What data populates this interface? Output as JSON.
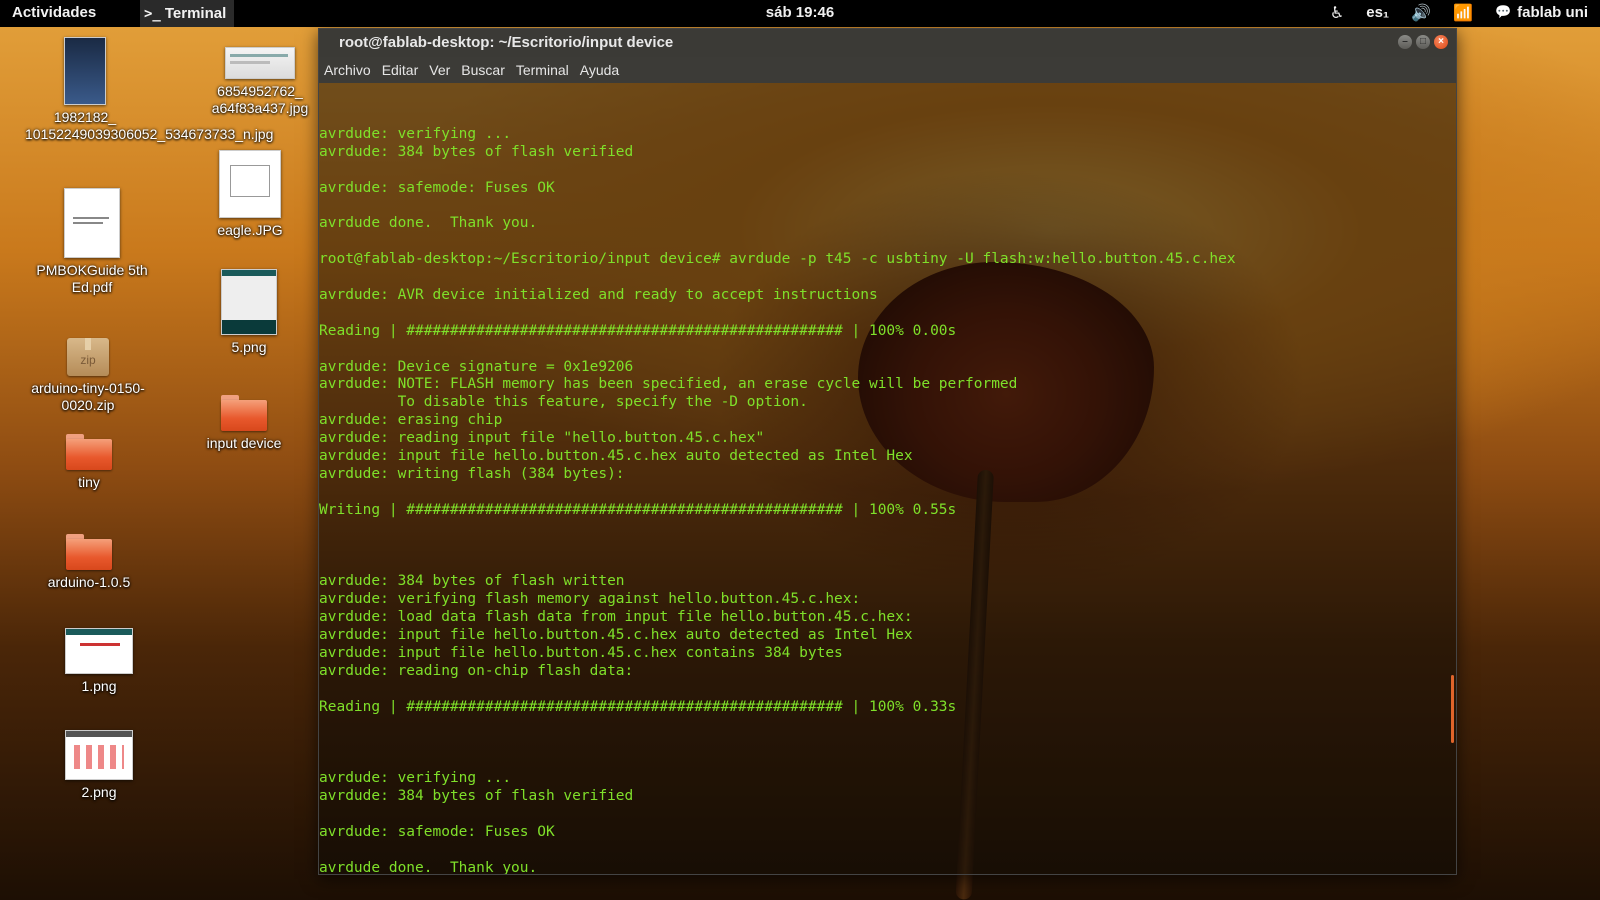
{
  "top_panel": {
    "activities": "Actividades",
    "app_name": "Terminal",
    "app_glyph": ">_",
    "clock": "sáb 19:46",
    "keyboard_layout": "es₁",
    "user": "fablab uni"
  },
  "desktop": {
    "icons": [
      {
        "label": "1982182_\n10152249039306052_534673733_n.jpg",
        "kind": "image-thumbnail"
      },
      {
        "label": "6854952762_\na64f83a437.jpg",
        "kind": "image-thumbnail"
      },
      {
        "label": "PMBOKGuide 5th Ed.pdf",
        "kind": "pdf-document"
      },
      {
        "label": "eagle.JPG",
        "kind": "image-thumbnail"
      },
      {
        "label": "5.png",
        "kind": "image-thumbnail"
      },
      {
        "label": "arduino-tiny-0150-0020.zip",
        "kind": "zip-archive"
      },
      {
        "label": "input device",
        "kind": "folder"
      },
      {
        "label": "tiny",
        "kind": "folder"
      },
      {
        "label": "arduino-1.0.5",
        "kind": "folder"
      },
      {
        "label": "1.png",
        "kind": "image-thumbnail"
      },
      {
        "label": "2.png",
        "kind": "image-thumbnail"
      }
    ]
  },
  "terminal": {
    "title": "root@fablab-desktop: ~/Escritorio/input device",
    "menu": [
      "Archivo",
      "Editar",
      "Ver",
      "Buscar",
      "Terminal",
      "Ayuda"
    ],
    "text_color": "#7fe02a",
    "lines": [
      "avrdude: verifying ...",
      "avrdude: 384 bytes of flash verified",
      "",
      "avrdude: safemode: Fuses OK",
      "",
      "avrdude done.  Thank you.",
      "",
      "root@fablab-desktop:~/Escritorio/input device# avrdude -p t45 -c usbtiny -U flash:w:hello.button.45.c.hex",
      "",
      "avrdude: AVR device initialized and ready to accept instructions",
      "",
      "Reading | ################################################## | 100% 0.00s",
      "",
      "avrdude: Device signature = 0x1e9206",
      "avrdude: NOTE: FLASH memory has been specified, an erase cycle will be performed",
      "         To disable this feature, specify the -D option.",
      "avrdude: erasing chip",
      "avrdude: reading input file \"hello.button.45.c.hex\"",
      "avrdude: input file hello.button.45.c.hex auto detected as Intel Hex",
      "avrdude: writing flash (384 bytes):",
      "",
      "Writing | ################################################## | 100% 0.55s",
      "",
      "",
      "",
      "avrdude: 384 bytes of flash written",
      "avrdude: verifying flash memory against hello.button.45.c.hex:",
      "avrdude: load data flash data from input file hello.button.45.c.hex:",
      "avrdude: input file hello.button.45.c.hex auto detected as Intel Hex",
      "avrdude: input file hello.button.45.c.hex contains 384 bytes",
      "avrdude: reading on-chip flash data:",
      "",
      "Reading | ################################################## | 100% 0.33s",
      "",
      "",
      "",
      "avrdude: verifying ...",
      "avrdude: 384 bytes of flash verified",
      "",
      "avrdude: safemode: Fuses OK",
      "",
      "avrdude done.  Thank you.",
      ""
    ]
  }
}
